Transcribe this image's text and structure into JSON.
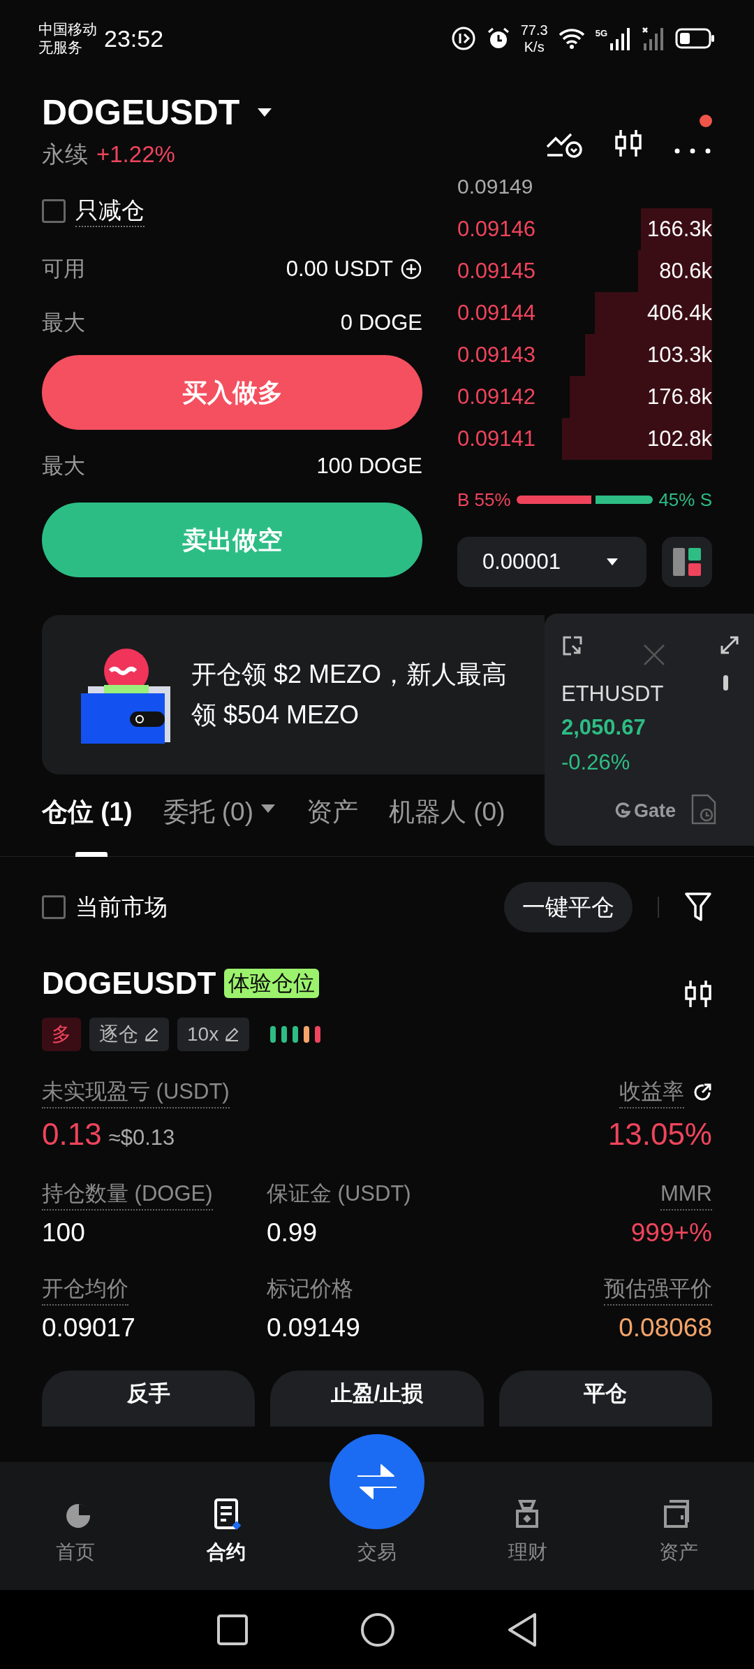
{
  "status_bar": {
    "carrier": "中国移动",
    "service": "无服务",
    "time": "23:52",
    "speed": "77.3",
    "speed_unit": "K/s",
    "network": "5G"
  },
  "header": {
    "symbol": "DOGEUSDT",
    "type": "永续",
    "change": "+1.22%",
    "notification": true
  },
  "order_form": {
    "reduce_only": {
      "label": "只减仓",
      "checked": false
    },
    "available": {
      "label": "可用",
      "value": "0.00 USDT"
    },
    "buy": {
      "max_label": "最大",
      "max_value": "0 DOGE",
      "button": "买入做多"
    },
    "sell": {
      "max_label": "最大",
      "max_value": "100 DOGE",
      "button": "卖出做空"
    }
  },
  "order_book": {
    "top_price": "0.09149",
    "asks": [
      {
        "price": "0.09146",
        "size": "166.3k"
      },
      {
        "price": "0.09145",
        "size": "80.6k"
      },
      {
        "price": "0.09144",
        "size": "406.4k"
      },
      {
        "price": "0.09143",
        "size": "103.3k"
      },
      {
        "price": "0.09142",
        "size": "176.8k"
      },
      {
        "price": "0.09141",
        "size": "102.8k"
      }
    ],
    "ratio": {
      "buy_label": "B 55%",
      "sell_label": "45% S"
    },
    "precision": "0.00001"
  },
  "banner": {
    "text": "开仓领 $2 MEZO，新人最高领 $504 MEZO"
  },
  "mini_ticker": {
    "symbol": "ETHUSDT",
    "price": "2,050.67",
    "change": "-0.26%",
    "brand": "Gate"
  },
  "tabs": [
    {
      "label": "仓位 (1)",
      "selected": true,
      "dropdown": false
    },
    {
      "label": "委托 (0)",
      "selected": false,
      "dropdown": true
    },
    {
      "label": "资产",
      "selected": false,
      "dropdown": false
    },
    {
      "label": "机器人 (0)",
      "selected": false,
      "dropdown": false
    }
  ],
  "filter": {
    "label": "当前市场",
    "checked": false,
    "close_all": "一键平仓"
  },
  "position": {
    "symbol": "DOGEUSDT",
    "badge": "体验仓位",
    "tags": [
      {
        "kind": "side",
        "label": "多"
      },
      {
        "kind": "editable",
        "label": "逐仓"
      },
      {
        "kind": "editable",
        "label": "10x"
      }
    ],
    "stats": [
      [
        {
          "label": "未实现盈亏 (USDT)",
          "value": "0.13",
          "sub": "≈$0.13",
          "color": "#f0445c",
          "dotted": true
        },
        {
          "label": "收益率",
          "value": "13.05%",
          "color": "#f0445c",
          "dotted": true
        }
      ],
      [
        {
          "label": "持仓数量 (DOGE)",
          "value": "100",
          "color": "#ffffff",
          "dotted": true
        },
        {
          "label": "保证金 (USDT)",
          "value": "0.99",
          "color": "#ffffff",
          "dotted": false
        },
        {
          "label": "MMR",
          "value": "999+%",
          "color": "#f0445c",
          "dotted": true
        }
      ],
      [
        {
          "label": "开仓均价",
          "value": "0.09017",
          "color": "#ffffff",
          "dotted": true
        },
        {
          "label": "标记价格",
          "value": "0.09149",
          "color": "#ffffff",
          "dotted": false
        },
        {
          "label": "预估强平价",
          "value": "0.08068",
          "color": "#f5a46a",
          "dotted": true
        }
      ]
    ],
    "actions": [
      "反手",
      "止盈/止损",
      "平仓"
    ]
  },
  "bottom_nav": [
    {
      "label": "首页",
      "kind": "tab",
      "selected": false
    },
    {
      "label": "合约",
      "kind": "tab",
      "selected": true
    },
    {
      "label": "交易",
      "kind": "fab",
      "selected": false
    },
    {
      "label": "理财",
      "kind": "tab",
      "selected": false
    },
    {
      "label": "资产",
      "kind": "tab",
      "selected": false
    }
  ]
}
